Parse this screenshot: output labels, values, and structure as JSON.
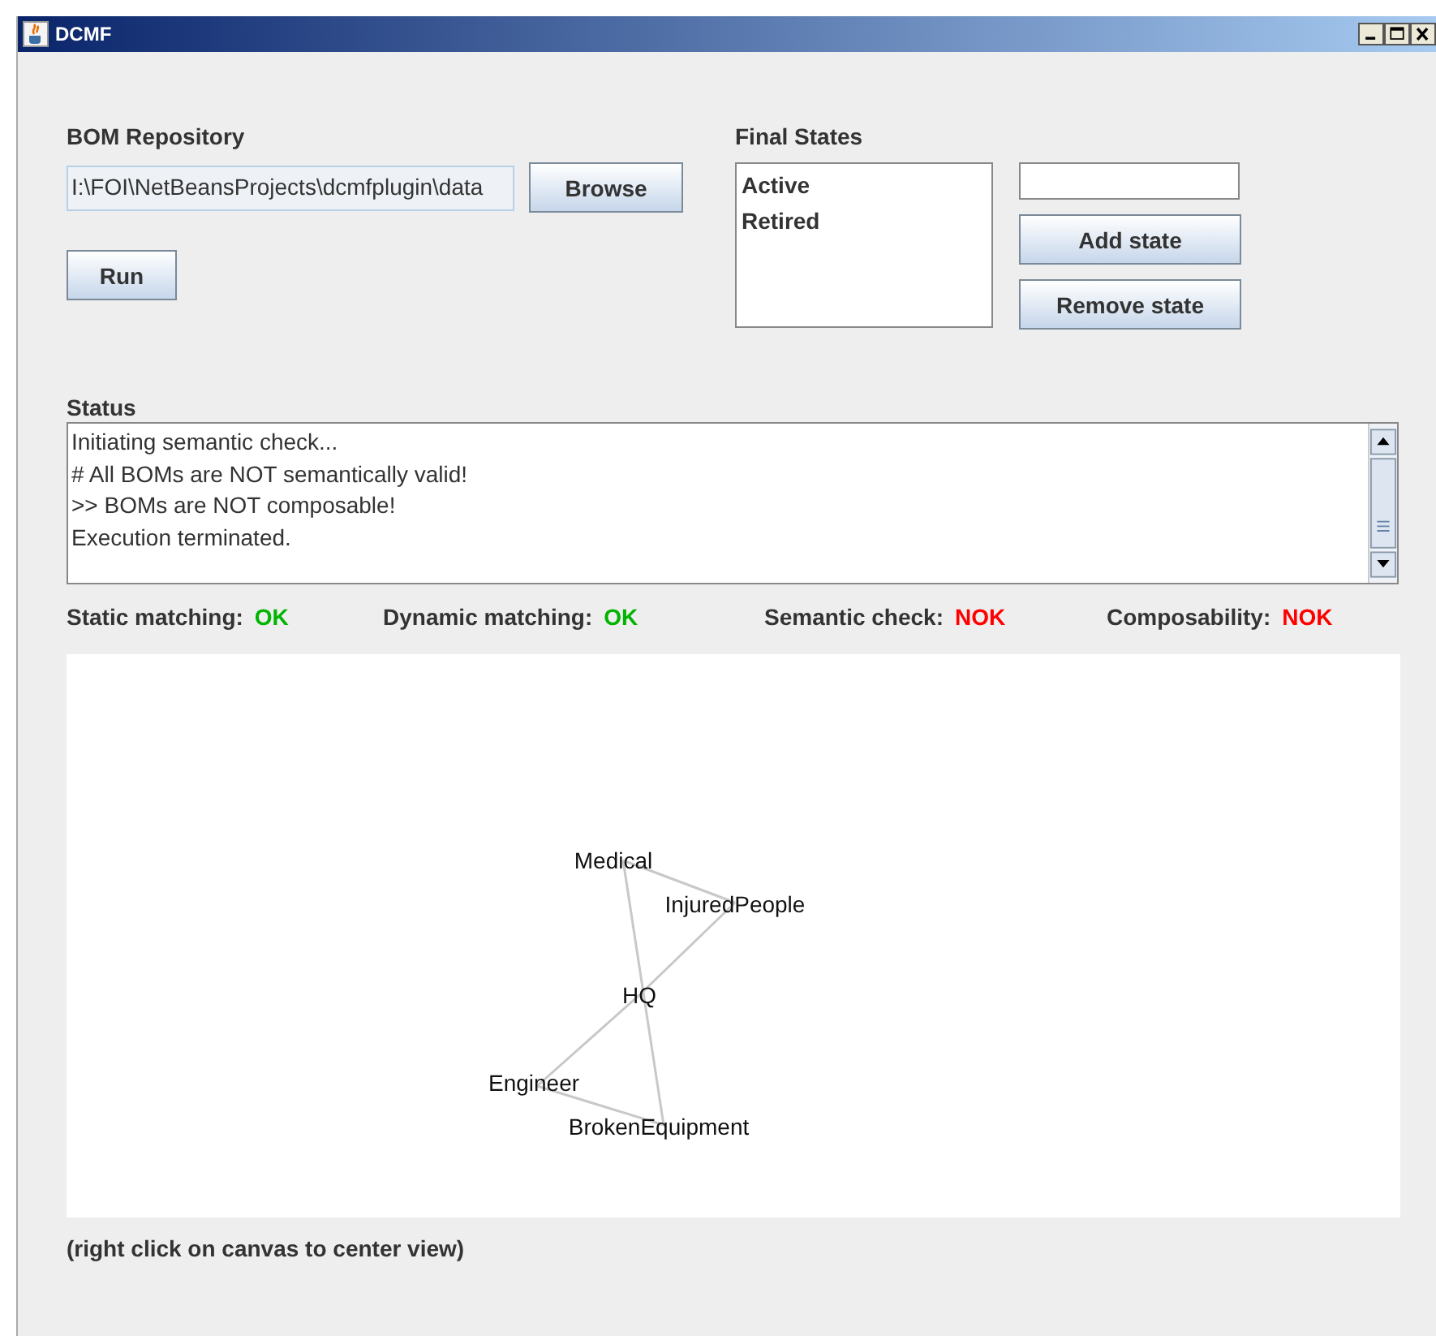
{
  "window": {
    "title": "DCMF"
  },
  "bom_repository": {
    "label": "BOM Repository",
    "path": "I:\\FOI\\NetBeansProjects\\dcmfplugin\\data",
    "browse_button": "Browse",
    "run_button": "Run"
  },
  "final_states": {
    "label": "Final States",
    "items": [
      {
        "label": "Active",
        "selected": false
      },
      {
        "label": "Retired",
        "selected": false
      }
    ],
    "add_button": "Add state",
    "remove_button": "Remove state"
  },
  "status": {
    "label": "Status",
    "lines": [
      "Initiating semantic check...",
      "# All BOMs are NOT semantically valid!",
      ">> BOMs are NOT composable!",
      "Execution terminated."
    ]
  },
  "checks": [
    {
      "label": "Static matching:",
      "value": "OK",
      "color": "#00b400"
    },
    {
      "label": "Dynamic matching:",
      "value": "OK",
      "color": "#00b400"
    },
    {
      "label": "Semantic check:",
      "value": "NOK",
      "color": "#ff0000"
    },
    {
      "label": "Composability:",
      "value": "NOK",
      "color": "#ff0000"
    }
  ],
  "graph": {
    "nodes": [
      "Medical",
      "InjuredPeople",
      "HQ",
      "Engineer",
      "BrokenEquipment"
    ]
  },
  "hint": "(right click on canvas to center view)"
}
